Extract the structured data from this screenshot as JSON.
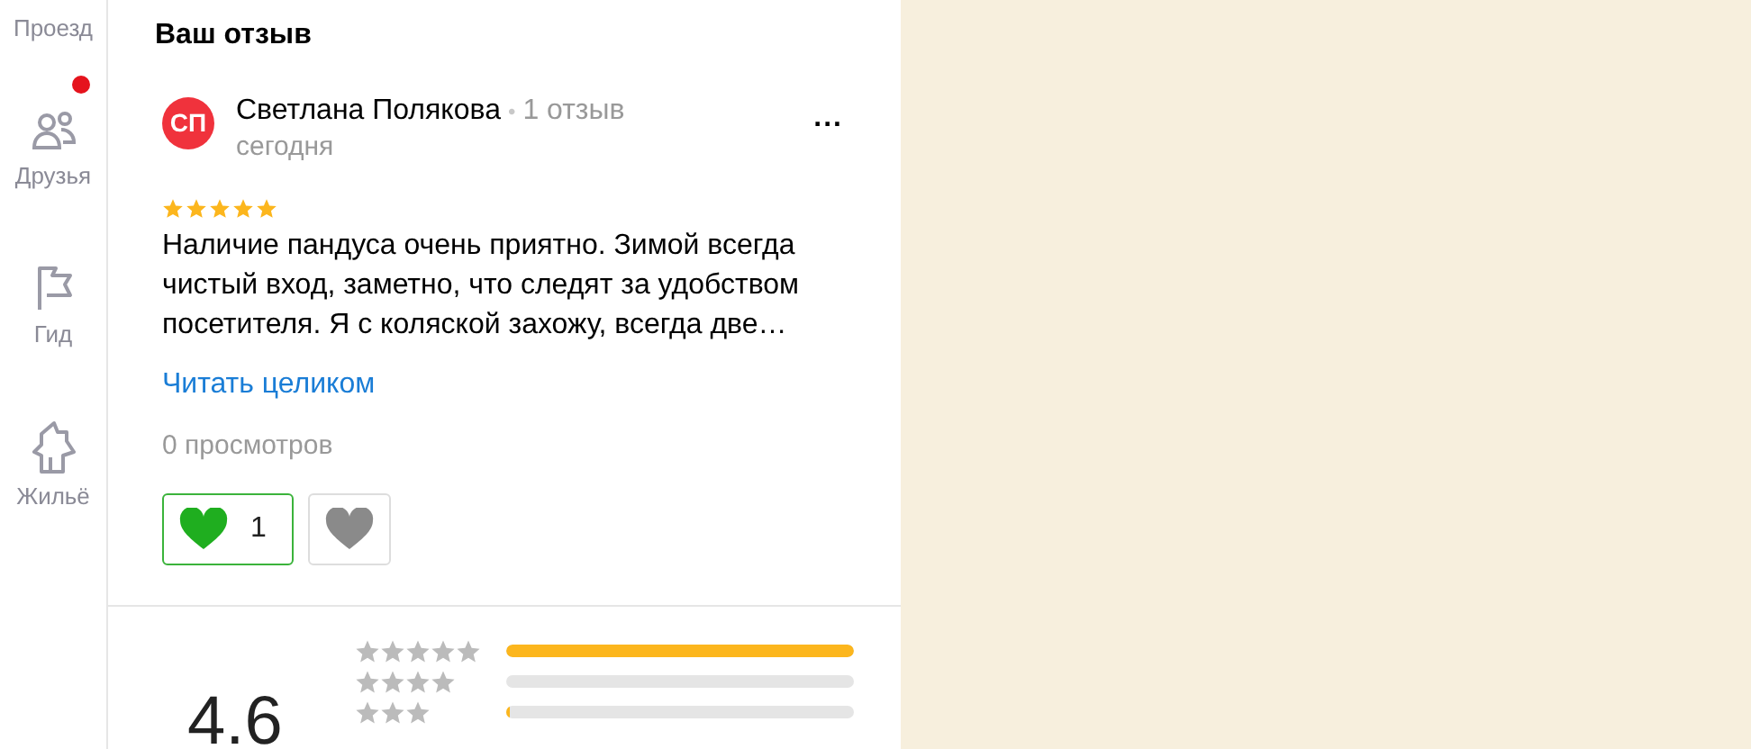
{
  "sidebar": {
    "items": [
      {
        "label": "Проезд",
        "badge": false
      },
      {
        "label": "Друзья",
        "badge": true
      },
      {
        "label": "Гид",
        "badge": false
      },
      {
        "label": "Жильё",
        "badge": false
      }
    ]
  },
  "review_section": {
    "title": "Ваш отзыв",
    "review": {
      "avatar_initials": "СП",
      "author": "Светлана Полякова",
      "separator": "•",
      "review_count": "1 отзыв",
      "more": "...",
      "date": "сегодня",
      "stars": 5,
      "text": "Наличие пандуса очень приятно. Зимой всегда чистый вход, заметно, что следят за удобством посетителя. Я с коляской захожу, всегда две…",
      "read_more": "Читать целиком",
      "views": "0 просмотров",
      "reactions": [
        {
          "kind": "like",
          "count": "1",
          "selected": true
        },
        {
          "kind": "like",
          "selected": false
        }
      ]
    }
  },
  "rating": {
    "score": "4.6",
    "rows": [
      {
        "level": 1.0
      },
      {
        "level": 0.0
      },
      {
        "level": 0.012
      }
    ]
  }
}
